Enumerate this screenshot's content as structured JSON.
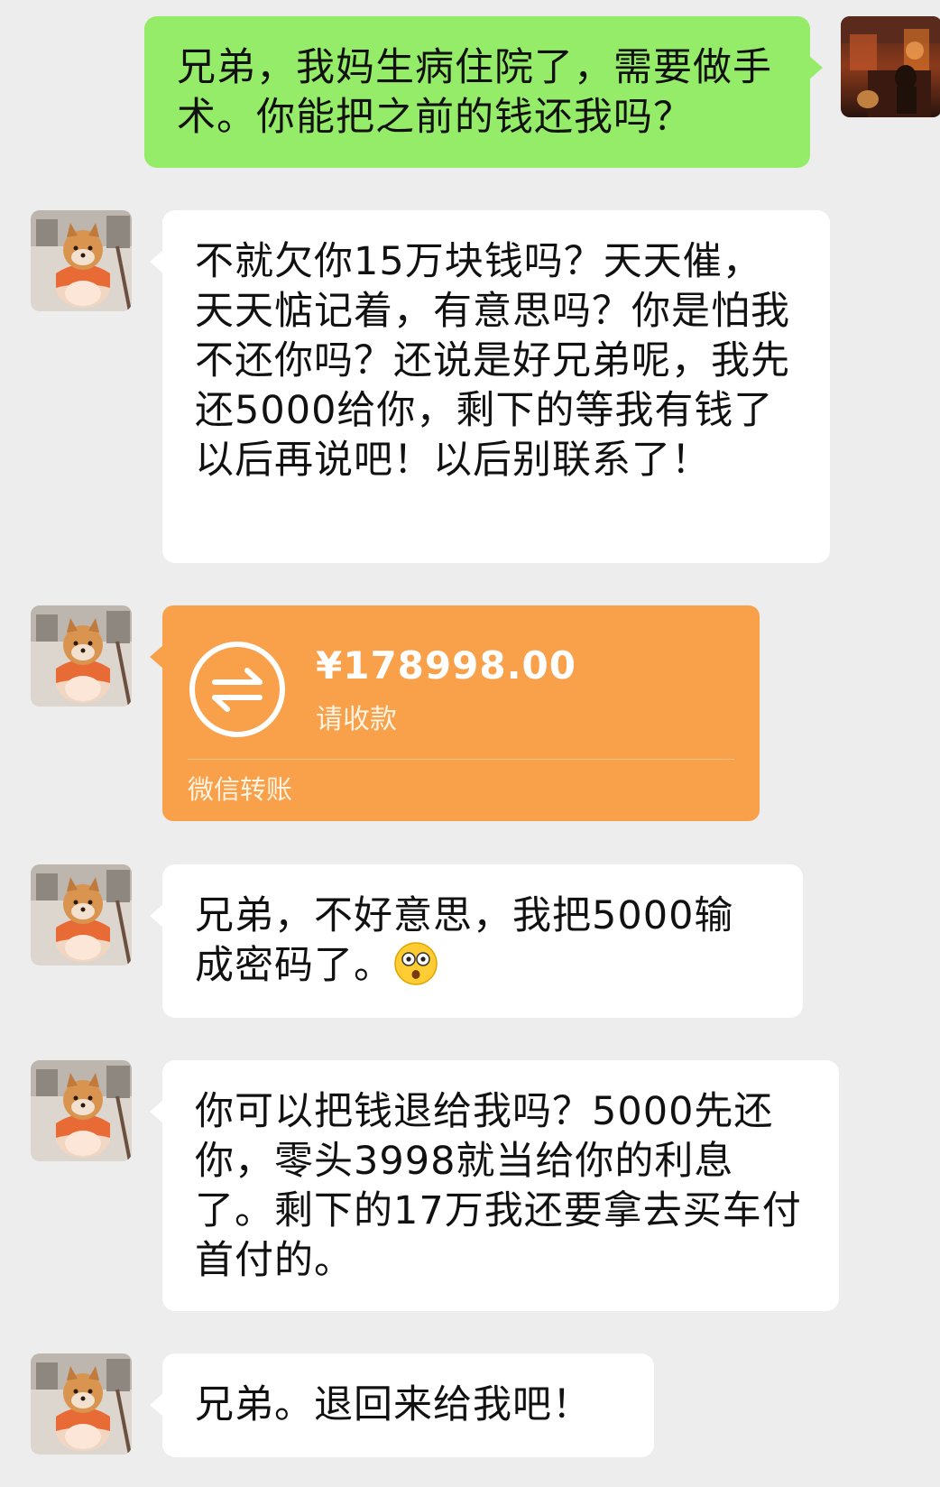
{
  "messages": [
    {
      "sender": "self",
      "text": "兄弟，我妈生病住院了，需要做手术。你能把之前的钱还我吗？"
    },
    {
      "sender": "other",
      "text": "不就欠你15万块钱吗？天天催，天天惦记着，有意思吗？你是怕我不还你吗？还说是好兄弟呢，我先还5000给你，剩下的等我有钱了以后再说吧！以后别联系了！"
    },
    {
      "sender": "other",
      "type": "transfer",
      "amount": "¥178998.00",
      "status": "请收款",
      "footer": "微信转账"
    },
    {
      "sender": "other",
      "text": "兄弟，不好意思，我把5000输成密码了。",
      "emoji": "astonished-face"
    },
    {
      "sender": "other",
      "text": "你可以把钱退给我吗？5000先还你，零头3998就当给你的利息了。剩下的17万我还要拿去买车付首付的。"
    },
    {
      "sender": "other",
      "text": "兄弟。退回来给我吧！"
    }
  ],
  "colors": {
    "background": "#ededed",
    "self_bubble": "#95ec69",
    "other_bubble": "#ffffff",
    "transfer_card": "#f8a04a"
  }
}
